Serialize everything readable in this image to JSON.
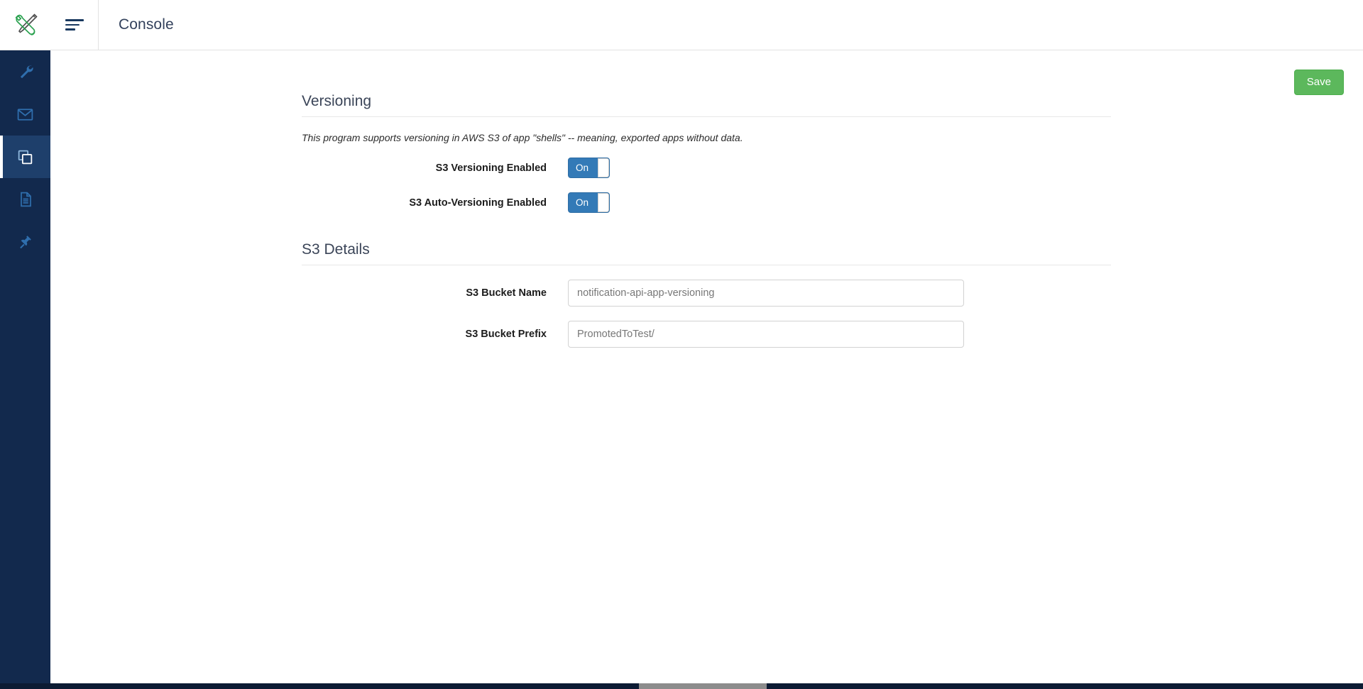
{
  "app": {
    "logo_icon": "tools-wrench-screwdriver-icon",
    "menu_toggle_icon": "hamburger-menu-icon",
    "title": "Console"
  },
  "sidebar": {
    "items": [
      {
        "icon": "wrench-icon",
        "name": "sidebar-item-tools",
        "active": false
      },
      {
        "icon": "envelope-icon",
        "name": "sidebar-item-messages",
        "active": false
      },
      {
        "icon": "copy-icon",
        "name": "sidebar-item-apps",
        "active": true
      },
      {
        "icon": "document-icon",
        "name": "sidebar-item-documents",
        "active": false
      },
      {
        "icon": "plug-icon",
        "name": "sidebar-item-integrations",
        "active": false
      }
    ]
  },
  "toolbar": {
    "save_label": "Save"
  },
  "sections": {
    "versioning": {
      "heading": "Versioning",
      "description": "This program supports versioning in AWS S3 of app \"shells\" -- meaning, exported apps without data.",
      "fields": [
        {
          "label": "S3 Versioning Enabled",
          "type": "toggle",
          "value": "On",
          "state": "on"
        },
        {
          "label": "S3 Auto-Versioning Enabled",
          "type": "toggle",
          "value": "On",
          "state": "on"
        }
      ]
    },
    "s3_details": {
      "heading": "S3 Details",
      "fields": [
        {
          "label": "S3 Bucket Name",
          "type": "text",
          "value": "notification-api-app-versioning",
          "placeholder": "notification-api-app-versioning"
        },
        {
          "label": "S3 Bucket Prefix",
          "type": "text",
          "value": "PromotedToTest/",
          "placeholder": "PromotedToTest/"
        }
      ]
    }
  },
  "colors": {
    "sidebar_bg": "#12294d",
    "sidebar_active_bg": "#1e3f6b",
    "toggle_on": "#337ab7",
    "save_green": "#5cb85c",
    "icon_blue": "#2f6ead",
    "logo_green": "#2aa14f",
    "title_text": "#33415c"
  }
}
